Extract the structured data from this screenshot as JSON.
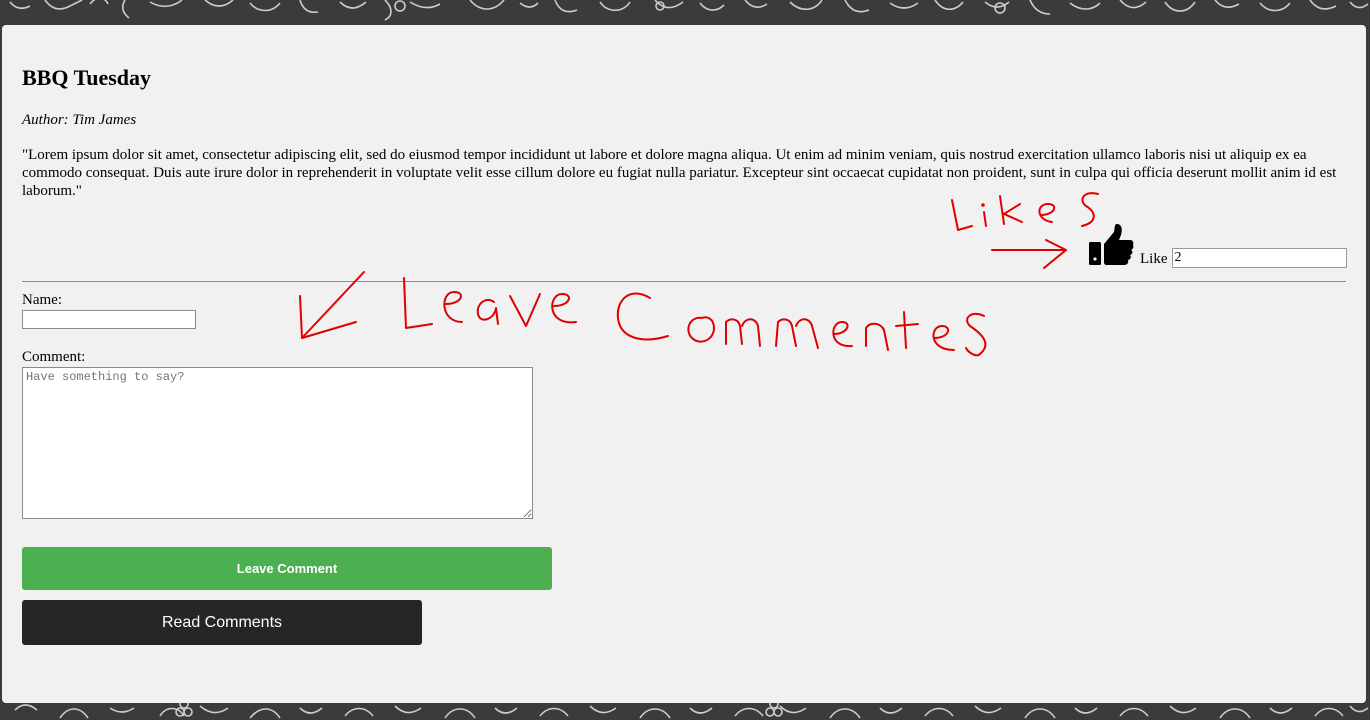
{
  "post": {
    "title": "BBQ Tuesday",
    "author": "Author: Tim James",
    "body": "\"Lorem ipsum dolor sit amet, consectetur adipiscing elit, sed do eiusmod tempor incididunt ut labore et dolore magna aliqua. Ut enim ad minim veniam, quis nostrud exercitation ullamco laboris nisi ut aliquip ex ea commodo consequat. Duis aute irure dolor in reprehenderit in voluptate velit esse cillum dolore eu fugiat nulla pariatur. Excepteur sint occaecat cupidatat non proident, sunt in culpa qui officia deserunt mollit anim id est laborum.\""
  },
  "likes": {
    "icon": "thumbs-up-icon",
    "label": "Like",
    "count": "2"
  },
  "form": {
    "name_label": "Name:",
    "name_value": "",
    "comment_label": "Comment:",
    "comment_placeholder": "Have something to say?",
    "leave_button": "Leave Comment",
    "read_button": "Read Comments"
  },
  "annotations": {
    "likes_text": "Likes",
    "comments_text": "Leave Comments",
    "color": "#e00000"
  },
  "colors": {
    "page_background": "#3b3b3b",
    "card_background": "#f1f1f1",
    "leave_button": "#4caf50",
    "read_button": "#262626"
  }
}
